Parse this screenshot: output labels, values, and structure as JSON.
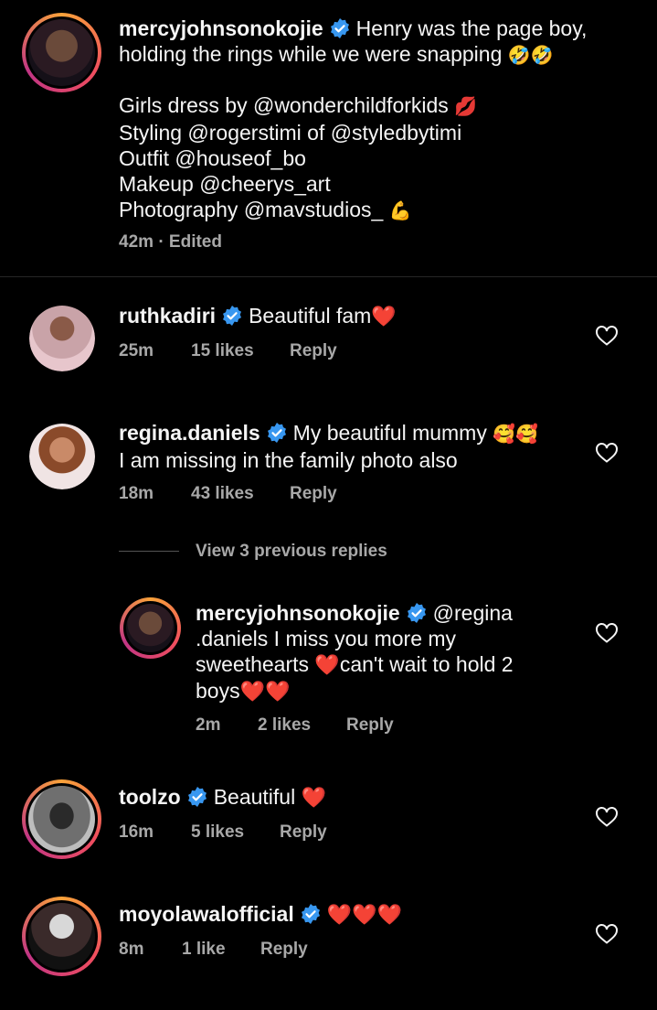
{
  "caption": {
    "username": "mercyjohnsonokojie",
    "text_line1": "Henry was the page boy,",
    "text_line2": "holding the rings while we were snapping",
    "emoji_line2": "🤣🤣",
    "credits": [
      {
        "text": "Girls dress by @wonderchildforkids",
        "emoji": "💋"
      },
      {
        "text": "Styling @rogerstimi of @styledbytimi",
        "emoji": ""
      },
      {
        "text": "Outfit @houseof_bo",
        "emoji": ""
      },
      {
        "text": "Makeup @cheerys_art",
        "emoji": ""
      },
      {
        "text": "Photography @mavstudios_",
        "emoji": "💪"
      }
    ],
    "time": "42m",
    "separator": "·",
    "edited": "Edited"
  },
  "comments": [
    {
      "username": "ruthkadiri",
      "text": "Beautiful  fam",
      "emoji": "❤️",
      "time": "25m",
      "likes": "15 likes",
      "reply": "Reply"
    },
    {
      "username": "regina.daniels",
      "text_line1": "My beautiful mummy",
      "emoji": "🥰🥰",
      "text_line2": "I am missing in the family photo also",
      "time": "18m",
      "likes": "43 likes",
      "reply": "Reply",
      "view_replies": "View 3 previous replies",
      "replies": [
        {
          "username": "mercyjohnsonokojie",
          "line1": "@regina",
          "line2": ".daniels  I miss you more my",
          "line3a": "sweethearts ",
          "heart3": "❤️",
          "line3b": "can't wait to hold 2",
          "line4": "boys",
          "heart4": "❤️❤️",
          "time": "2m",
          "likes": "2 likes",
          "reply": "Reply"
        }
      ]
    },
    {
      "username": "toolzo",
      "text": "Beautiful ",
      "emoji": "❤️",
      "time": "16m",
      "likes": "5 likes",
      "reply": "Reply"
    },
    {
      "username": "moyolawalofficial",
      "text": "",
      "emoji": "❤️❤️❤️",
      "time": "8m",
      "likes": "1 like",
      "reply": "Reply"
    }
  ],
  "colors": {
    "background": "#000000",
    "text": "#f5f5f5",
    "muted": "#a8a8a8",
    "verified": "#3897f0",
    "heart": "#ff2d3a"
  },
  "icons": [
    "verified-badge-icon",
    "heart-outline-icon"
  ]
}
